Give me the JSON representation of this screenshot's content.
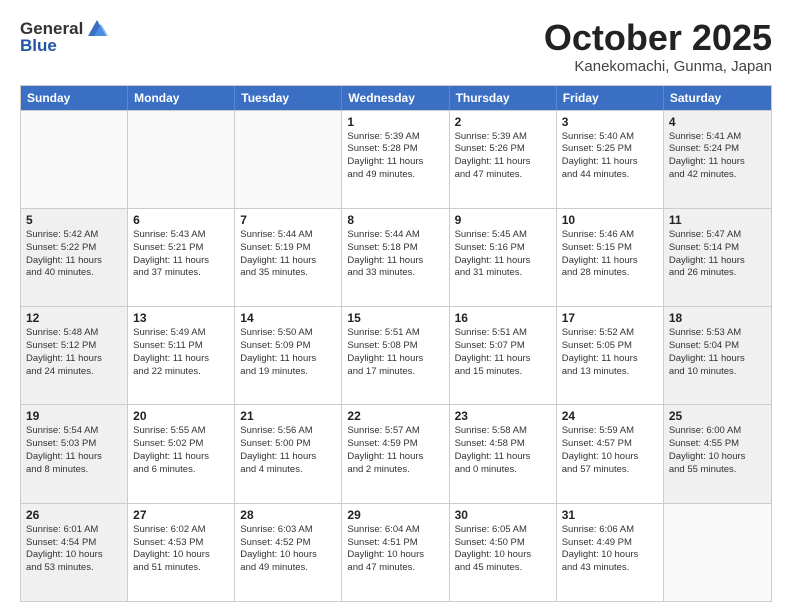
{
  "logo": {
    "general": "General",
    "blue": "Blue"
  },
  "header": {
    "month": "October 2025",
    "location": "Kanekomachi, Gunma, Japan"
  },
  "weekdays": [
    "Sunday",
    "Monday",
    "Tuesday",
    "Wednesday",
    "Thursday",
    "Friday",
    "Saturday"
  ],
  "weeks": [
    [
      {
        "day": "",
        "info": ""
      },
      {
        "day": "",
        "info": ""
      },
      {
        "day": "",
        "info": ""
      },
      {
        "day": "1",
        "info": "Sunrise: 5:39 AM\nSunset: 5:28 PM\nDaylight: 11 hours\nand 49 minutes."
      },
      {
        "day": "2",
        "info": "Sunrise: 5:39 AM\nSunset: 5:26 PM\nDaylight: 11 hours\nand 47 minutes."
      },
      {
        "day": "3",
        "info": "Sunrise: 5:40 AM\nSunset: 5:25 PM\nDaylight: 11 hours\nand 44 minutes."
      },
      {
        "day": "4",
        "info": "Sunrise: 5:41 AM\nSunset: 5:24 PM\nDaylight: 11 hours\nand 42 minutes."
      }
    ],
    [
      {
        "day": "5",
        "info": "Sunrise: 5:42 AM\nSunset: 5:22 PM\nDaylight: 11 hours\nand 40 minutes."
      },
      {
        "day": "6",
        "info": "Sunrise: 5:43 AM\nSunset: 5:21 PM\nDaylight: 11 hours\nand 37 minutes."
      },
      {
        "day": "7",
        "info": "Sunrise: 5:44 AM\nSunset: 5:19 PM\nDaylight: 11 hours\nand 35 minutes."
      },
      {
        "day": "8",
        "info": "Sunrise: 5:44 AM\nSunset: 5:18 PM\nDaylight: 11 hours\nand 33 minutes."
      },
      {
        "day": "9",
        "info": "Sunrise: 5:45 AM\nSunset: 5:16 PM\nDaylight: 11 hours\nand 31 minutes."
      },
      {
        "day": "10",
        "info": "Sunrise: 5:46 AM\nSunset: 5:15 PM\nDaylight: 11 hours\nand 28 minutes."
      },
      {
        "day": "11",
        "info": "Sunrise: 5:47 AM\nSunset: 5:14 PM\nDaylight: 11 hours\nand 26 minutes."
      }
    ],
    [
      {
        "day": "12",
        "info": "Sunrise: 5:48 AM\nSunset: 5:12 PM\nDaylight: 11 hours\nand 24 minutes."
      },
      {
        "day": "13",
        "info": "Sunrise: 5:49 AM\nSunset: 5:11 PM\nDaylight: 11 hours\nand 22 minutes."
      },
      {
        "day": "14",
        "info": "Sunrise: 5:50 AM\nSunset: 5:09 PM\nDaylight: 11 hours\nand 19 minutes."
      },
      {
        "day": "15",
        "info": "Sunrise: 5:51 AM\nSunset: 5:08 PM\nDaylight: 11 hours\nand 17 minutes."
      },
      {
        "day": "16",
        "info": "Sunrise: 5:51 AM\nSunset: 5:07 PM\nDaylight: 11 hours\nand 15 minutes."
      },
      {
        "day": "17",
        "info": "Sunrise: 5:52 AM\nSunset: 5:05 PM\nDaylight: 11 hours\nand 13 minutes."
      },
      {
        "day": "18",
        "info": "Sunrise: 5:53 AM\nSunset: 5:04 PM\nDaylight: 11 hours\nand 10 minutes."
      }
    ],
    [
      {
        "day": "19",
        "info": "Sunrise: 5:54 AM\nSunset: 5:03 PM\nDaylight: 11 hours\nand 8 minutes."
      },
      {
        "day": "20",
        "info": "Sunrise: 5:55 AM\nSunset: 5:02 PM\nDaylight: 11 hours\nand 6 minutes."
      },
      {
        "day": "21",
        "info": "Sunrise: 5:56 AM\nSunset: 5:00 PM\nDaylight: 11 hours\nand 4 minutes."
      },
      {
        "day": "22",
        "info": "Sunrise: 5:57 AM\nSunset: 4:59 PM\nDaylight: 11 hours\nand 2 minutes."
      },
      {
        "day": "23",
        "info": "Sunrise: 5:58 AM\nSunset: 4:58 PM\nDaylight: 11 hours\nand 0 minutes."
      },
      {
        "day": "24",
        "info": "Sunrise: 5:59 AM\nSunset: 4:57 PM\nDaylight: 10 hours\nand 57 minutes."
      },
      {
        "day": "25",
        "info": "Sunrise: 6:00 AM\nSunset: 4:55 PM\nDaylight: 10 hours\nand 55 minutes."
      }
    ],
    [
      {
        "day": "26",
        "info": "Sunrise: 6:01 AM\nSunset: 4:54 PM\nDaylight: 10 hours\nand 53 minutes."
      },
      {
        "day": "27",
        "info": "Sunrise: 6:02 AM\nSunset: 4:53 PM\nDaylight: 10 hours\nand 51 minutes."
      },
      {
        "day": "28",
        "info": "Sunrise: 6:03 AM\nSunset: 4:52 PM\nDaylight: 10 hours\nand 49 minutes."
      },
      {
        "day": "29",
        "info": "Sunrise: 6:04 AM\nSunset: 4:51 PM\nDaylight: 10 hours\nand 47 minutes."
      },
      {
        "day": "30",
        "info": "Sunrise: 6:05 AM\nSunset: 4:50 PM\nDaylight: 10 hours\nand 45 minutes."
      },
      {
        "day": "31",
        "info": "Sunrise: 6:06 AM\nSunset: 4:49 PM\nDaylight: 10 hours\nand 43 minutes."
      },
      {
        "day": "",
        "info": ""
      }
    ]
  ]
}
